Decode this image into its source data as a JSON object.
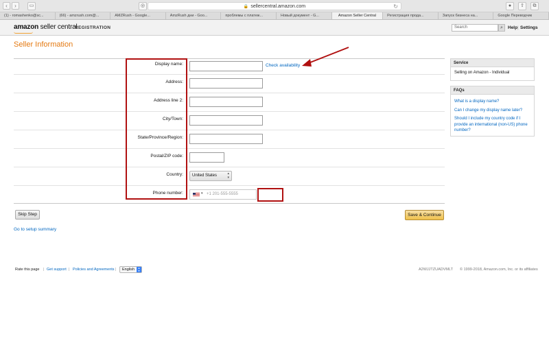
{
  "browser": {
    "url": "sellercentral.amazon.com",
    "tabs": [
      "(1) - romashenko@sc...",
      "(66) - amzrush.com@...",
      "AMZRush - Google...",
      "AmzRush дни - Goo...",
      "проблемы с платеж...",
      "Новый документ - G...",
      "Amazon Seller Central",
      "Регистрация прода...",
      "Запуск бизнеса на...",
      "Google Переводчик"
    ]
  },
  "header": {
    "logo_bold": "amazon",
    "logo_light": " seller central",
    "section": "REGISTRATION",
    "search_placeholder": "Search",
    "help": "Help",
    "settings": "Settings"
  },
  "page": {
    "title": "Seller Information"
  },
  "form": {
    "display_name_label": "Display name:",
    "check_availability": "Check availability",
    "address_label": "Address:",
    "address2_label": "Address line 2:",
    "city_label": "City/Town:",
    "state_label": "State/Province/Region:",
    "postal_label": "Postal/ZIP code:",
    "country_label": "Country:",
    "country_value": "United States",
    "phone_label": "Phone number:",
    "phone_placeholder": "+1 201-555-5555"
  },
  "actions": {
    "skip": "Skip Step",
    "save": "Save & Continue",
    "setup_link": "Go to setup summary"
  },
  "sidebar": {
    "service_title": "Service",
    "service_value": "Selling on Amazon - Individual",
    "faqs_title": "FAQs",
    "faqs": [
      "What is a display name?",
      "Can I change my display name later?",
      "Should I include my country code if I provide an international (non-US) phone number?"
    ]
  },
  "footer": {
    "rate": "Rate this page",
    "support": "Get support",
    "policies": "Policies and Agreements",
    "language": "English",
    "code": "A2WJJTZUADVMLT",
    "copyright": "© 1999-2018, Amazon.com, Inc. or its affiliates"
  },
  "colors": {
    "title_orange": "#e47911",
    "link_blue": "#0066c0",
    "annotation_red": "#b01010",
    "save_button": "#f0c14b"
  }
}
